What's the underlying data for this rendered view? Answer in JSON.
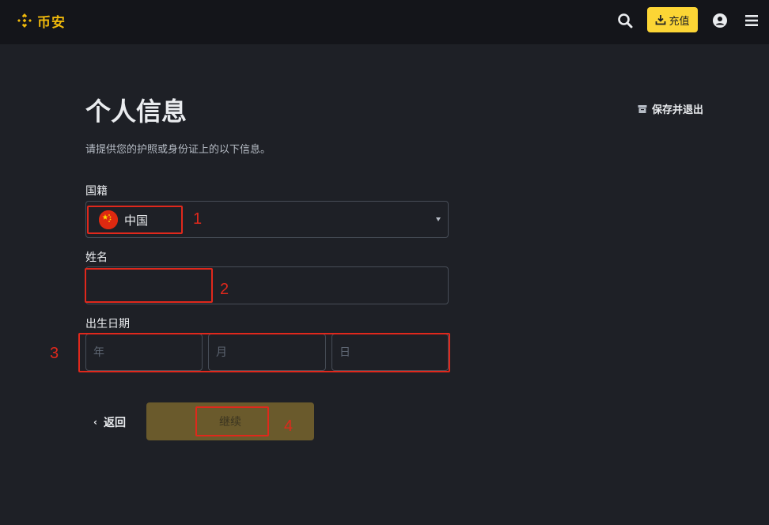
{
  "header": {
    "logo_text": "币安",
    "deposit_label": "充值",
    "icons": [
      "search-icon",
      "download-icon",
      "user-icon",
      "menu-icon"
    ],
    "brand_color": "#f0b90b",
    "accent_color": "#fcd535"
  },
  "page": {
    "title": "个人信息",
    "save_exit_label": "保存并退出",
    "subtitle": "请提供您的护照或身份证上的以下信息。"
  },
  "form": {
    "nationality_label": "国籍",
    "nationality_value": "中国",
    "name_label": "姓名",
    "name_value": "",
    "dob_label": "出生日期",
    "year_placeholder": "年",
    "month_placeholder": "月",
    "day_placeholder": "日"
  },
  "actions": {
    "back_label": "返回",
    "continue_label": "继续"
  },
  "annotations": {
    "color": "#e0281c",
    "labels": [
      "1",
      "2",
      "3",
      "4"
    ]
  }
}
